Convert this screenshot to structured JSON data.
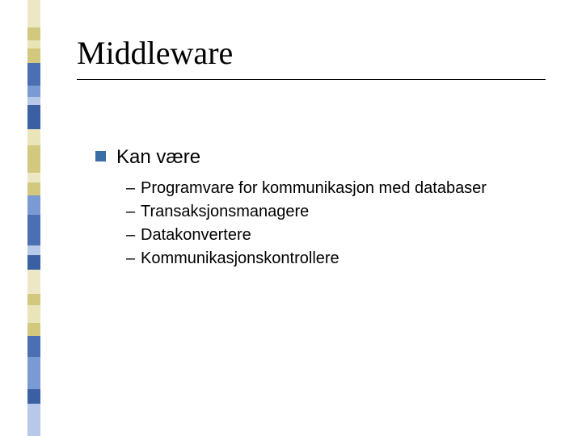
{
  "title": "Middleware",
  "level1": "Kan være",
  "sub": [
    "Programvare for kommunikasjon med databaser",
    "Transaksjonsmanagere",
    "Datakonvertere",
    "Kommunikasjonskontrollere"
  ],
  "strip_colors": [
    "#ece8c5",
    "#d3c97e",
    "#e9e5b8",
    "#d3c97e",
    "#4a6fb3",
    "#7a9ad4",
    "#b8c8e8",
    "#3a5fa3",
    "#e9e5b8",
    "#d3c97e",
    "#ece8c5",
    "#d3c97e",
    "#7a9ad4",
    "#4a6fb3",
    "#b8c8e8",
    "#3a5fa3",
    "#ece8c5",
    "#d3c97e",
    "#e9e5b8",
    "#d3c97e",
    "#4a6fb3",
    "#7a9ad4",
    "#3a5fa3",
    "#b8c8e8"
  ],
  "strip_heights": [
    34,
    16,
    10,
    18,
    28,
    14,
    10,
    30,
    20,
    34,
    12,
    16,
    24,
    38,
    12,
    18,
    30,
    14,
    22,
    16,
    26,
    40,
    18,
    40
  ]
}
